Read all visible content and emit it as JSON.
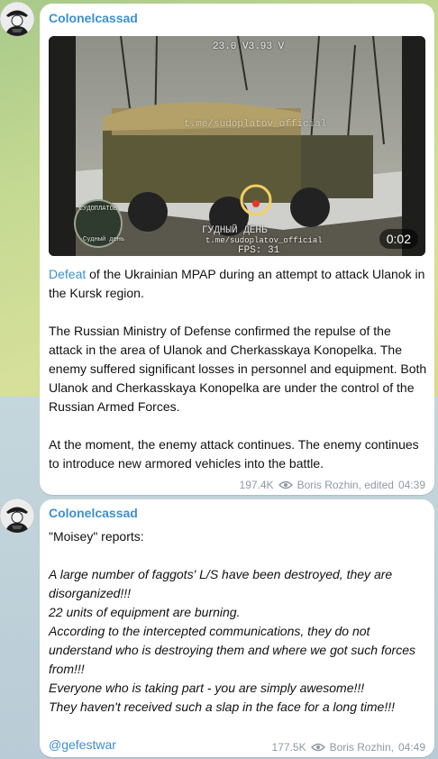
{
  "post1": {
    "author": "Colonelcassad",
    "video": {
      "duration": "0:02",
      "osd_top": "23.0  V3.93 V",
      "osd_mid": "t.me/sudoplatov_official",
      "osd_bottom1": "ГУДНЫЙ  ДЕНЬ",
      "osd_bottom2": "t.me/sudoplatov_official",
      "osd_fps": "FPS: 31",
      "logo_top": "СУДОПЛАТОВ",
      "logo_bottom": "Судный день"
    },
    "link_word": "Defeat",
    "para1_rest": " of the Ukrainian MPAP during an attempt to attack Ulanok in the Kursk region.",
    "para2": "The Russian Ministry of Defense confirmed the repulse of the attack in the area of Ulanok and Cherkasskaya Konopelka. The enemy suffered significant losses in personnel and equipment. Both Ulanok and Cherkasskaya Konopelka are under the control of the Russian Armed Forces.",
    "para3": "At the moment, the enemy attack continues. The enemy continues to introduce new armored vehicles into the battle.",
    "views": "197.4K",
    "signature": "Boris Rozhin, edited",
    "time": "04:39"
  },
  "post2": {
    "author": "Colonelcassad",
    "intro": "\"Moisey\" reports:",
    "lines": [
      "A large number of faggots' L/S have been destroyed, they are disorganized!!!",
      "22 units of equipment are burning.",
      "According to the intercepted communications, they do not understand who is destroying them and where we got such forces from!!!",
      "Everyone who is taking part - you are simply awesome!!!",
      "They haven't received such a slap in the face for a long time!!!"
    ],
    "link": "@gefestwar",
    "views": "177.5K",
    "signature": "Boris Rozhin,",
    "time": "04:49"
  },
  "colors": {
    "accent": "#3d8fd0",
    "meta": "#8e9aa4"
  }
}
